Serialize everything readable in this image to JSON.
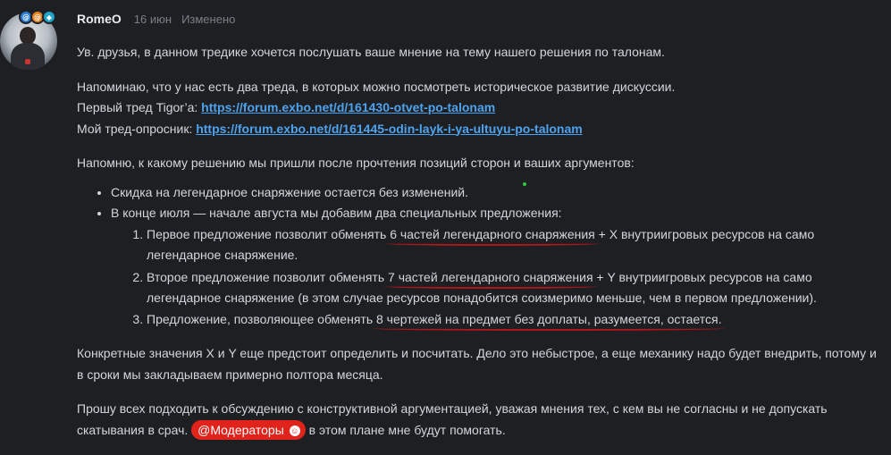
{
  "post": {
    "author": "RomeO",
    "date": "16 июн",
    "edited": "Изменено",
    "badges": [
      {
        "icon": "at-badge-icon",
        "color": "#2a7fd6"
      },
      {
        "icon": "at-badge-icon",
        "color": "#e88321"
      },
      {
        "icon": "diamond-badge-icon",
        "color": "#1ea3c9"
      }
    ],
    "intro": "Ув. друзья, в данном тредике хочется послушать ваше мнение на тему нашего решения по талонам.",
    "reminder": "Напоминаю, что у нас есть два треда, в которых можно посмотреть историческое развитие дискуссии.",
    "thread1_prefix": "Первый тред Tigor’a: ",
    "thread1_link": "https://forum.exbo.net/d/161430-otvet-po-talonam",
    "thread2_prefix": "Мой тред-опросник: ",
    "thread2_link": "https://forum.exbo.net/d/161445-odin-layk-i-ya-ultuyu-po-talonam",
    "decision_intro": "Напомню, к какому решению мы пришли после прочтения позиций сторон и ваших аргументов:",
    "bullet1": "Скидка на легендарное снаряжение остается без изменений.",
    "bullet2": "В конце июля — начале августа мы добавим два специальных предложения:",
    "offer1_a": "Первое предложение позволит обменять ",
    "offer1_u": "6 частей легендарного снаряжения",
    "offer1_b": " + X внутриигровых ресурсов на само легендарное снаряжение.",
    "offer2_a": "Второе предложение позволит обменять ",
    "offer2_u": "7 частей легендарного снаряжения",
    "offer2_b": " + Y внутриигровых ресурсов на само легендарное снаряжение (в этом случае ресурсов понадобится соизмеримо меньше, чем в первом предложении).",
    "offer3_a": "Предложение, позволяющее обменять ",
    "offer3_u": "8 чертежей на предмет без доплаты, разумеется, остается.",
    "values_note": "Конкретные значения X и Y еще предстоит определить и посчитать. Дело это небыстрое, а еще механику надо будет внедрить, потому и в сроки мы закладываем примерно полтора месяца.",
    "closing_a": "Прошу всех подходить к обсуждению с конструктивной аргументацией, уважая мнения тех, с кем вы не согласны и не допускать скатывания в срач. ",
    "mention": "@Модераторы",
    "closing_b": " в этом плане мне будут помогать."
  },
  "colors": {
    "background": "#1d1f23",
    "link": "#4da3f0",
    "mention": "#e0231b",
    "underline": "#b0161a"
  }
}
